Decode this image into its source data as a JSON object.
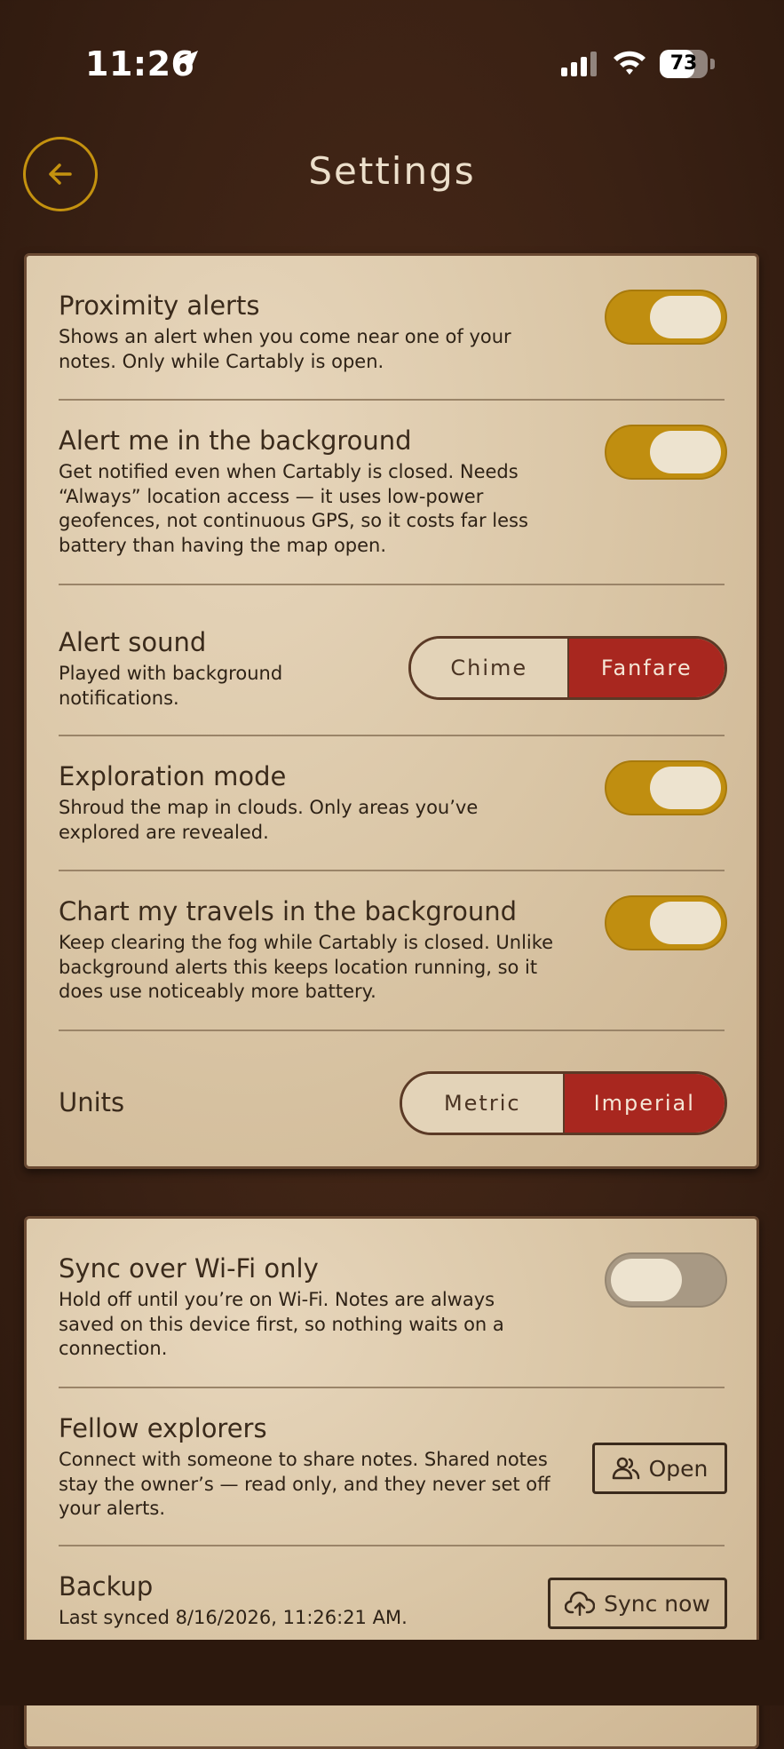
{
  "status_bar": {
    "time": "11:26",
    "battery_level": "73",
    "battery_fraction": 0.73
  },
  "header": {
    "title": "Settings"
  },
  "colors": {
    "toggle_on": "#c08e10",
    "segment_selected": "#a8271f",
    "card": "#dac6a6",
    "background": "#3a2114"
  },
  "settings": {
    "proximity_alerts": {
      "title": "Proximity alerts",
      "description": "Shows an alert when you come near one of your notes. Only while Cartably is open.",
      "enabled": true
    },
    "background_alerts": {
      "title": "Alert me in the background",
      "description": "Get notified even when Cartably is closed. Needs “Always” location access — it uses low-power geofences, not continuous GPS, so it costs far less battery than having the map open.",
      "enabled": true
    },
    "alert_sound": {
      "title": "Alert sound",
      "description": "Played with background notifications.",
      "options": [
        "Chime",
        "Fanfare"
      ],
      "selected": "Fanfare"
    },
    "exploration_mode": {
      "title": "Exploration mode",
      "description": "Shroud the map in clouds. Only areas you’ve explored are revealed.",
      "enabled": true
    },
    "chart_travels": {
      "title": "Chart my travels in the background",
      "description": "Keep clearing the fog while Cartably is closed. Unlike background alerts this keeps location running, so it does use noticeably more battery.",
      "enabled": true
    },
    "units": {
      "title": "Units",
      "options": [
        "Metric",
        "Imperial"
      ],
      "selected": "Imperial"
    },
    "sync_wifi": {
      "title": "Sync over Wi-Fi only",
      "description": "Hold off until you’re on Wi-Fi. Notes are always saved on this device first, so nothing waits on a connection.",
      "enabled": false
    },
    "fellow_explorers": {
      "title": "Fellow explorers",
      "description": "Connect with someone to share notes. Shared notes stay the owner’s — read only, and they never set off your alerts.",
      "button_label": "Open",
      "icon": "people-icon"
    },
    "backup": {
      "title": "Backup",
      "description": "Last synced 8/16/2026, 11:26:21 AM.",
      "button_label": "Sync now",
      "icon": "cloud-upload-icon"
    }
  }
}
